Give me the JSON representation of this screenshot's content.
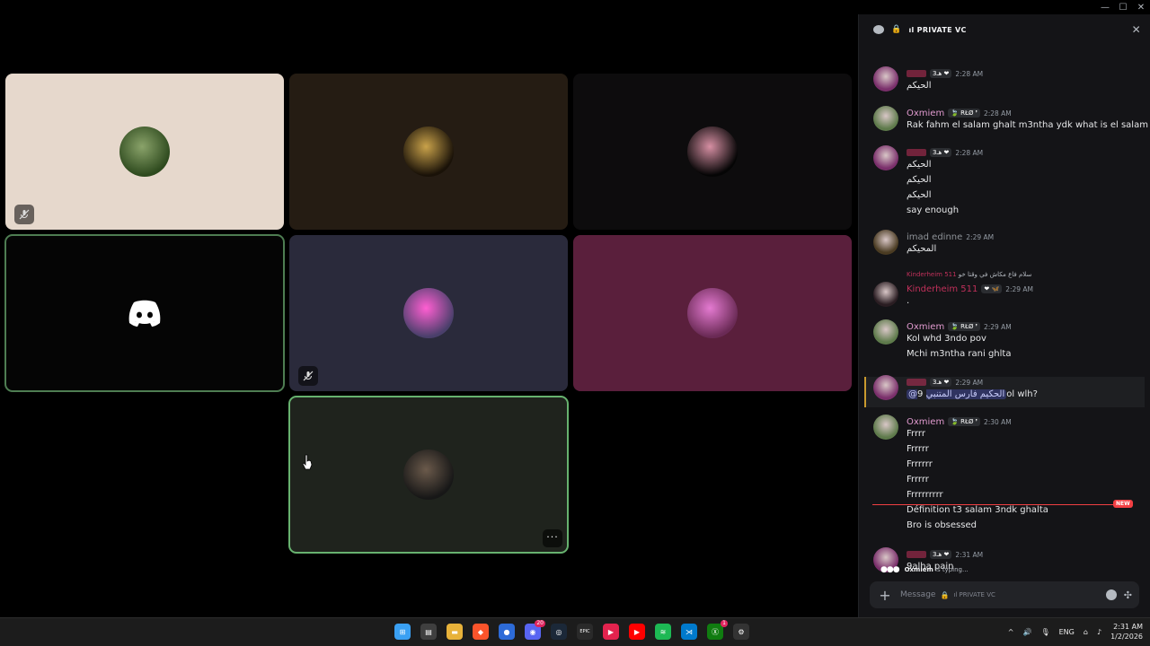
{
  "window_controls": {
    "minimize": "—",
    "maximize": "☐",
    "close": "✕"
  },
  "tiles": [
    {
      "id": "tile-1",
      "bg": "#e6d8cc",
      "avatar_colors": [
        "#2e4a1e",
        "#8aa36a"
      ],
      "muted": true
    },
    {
      "id": "tile-2",
      "bg": "#251c13",
      "avatar_colors": [
        "#1a1208",
        "#c9a24a"
      ],
      "muted": false
    },
    {
      "id": "tile-3",
      "bg": "#0d0c0d",
      "avatar_colors": [
        "#050505",
        "#d68fa3"
      ],
      "muted": false
    },
    {
      "id": "tile-4",
      "bg": "#050505",
      "avatar_colors": [
        "#050505",
        "#050505"
      ],
      "muted": false,
      "discord_logo": true,
      "speaking": true
    },
    {
      "id": "tile-5",
      "bg": "#2a2a3b",
      "avatar_colors": [
        "#4a3f6b",
        "#ff5fd2"
      ],
      "muted": true
    },
    {
      "id": "tile-6",
      "bg": "#5a1f3c",
      "avatar_colors": [
        "#6a2a55",
        "#e47ad1"
      ],
      "muted": false
    },
    {
      "id": "tile-7",
      "bg": "#1f231d",
      "avatar_colors": [
        "#171717",
        "#6b5a4b"
      ],
      "muted": false,
      "speaking": true,
      "more": "···"
    }
  ],
  "chat": {
    "title": "ıl PRIVATE VC",
    "messages": [
      {
        "name": "",
        "name_color": "#c0305a",
        "tag": "ﻫـ3 ❤",
        "time": "2:28 AM",
        "lines": [
          "الحيكم"
        ],
        "pfp": "#7a2f6b"
      },
      {
        "name": "Oxmiem",
        "name_color": "#e29bd0",
        "tag": "🍃 RŁØ ❜",
        "time": "2:28 AM",
        "lines": [
          "Rak fahm el salam ghalt m3ntha ydk what is el salam"
        ],
        "pfp": "#5e7a4b"
      },
      {
        "name": "",
        "name_color": "#c0305a",
        "tag": "ﻫـ3 ❤",
        "time": "2:28 AM",
        "lines": [
          "الحيكم",
          "الحيكم",
          "الحيكم",
          "say enough"
        ],
        "pfp": "#7a2f6b"
      },
      {
        "name": "imad edinne",
        "name_color": "#8e9297",
        "tag": "",
        "time": "2:29 AM",
        "lines": [
          "المحيكم"
        ],
        "pfp": "#4a3b22"
      },
      {
        "reply_text": "سلام فاع مكاش في وقتا خو",
        "reply_name": "Kinderheim 511",
        "name": "Kinderheim 511",
        "name_color": "#c0305a",
        "tag": "❤ 🦋",
        "time": "2:29 AM",
        "lines": [
          "."
        ],
        "pfp": "#2a1d22"
      },
      {
        "name": "Oxmiem",
        "name_color": "#e29bd0",
        "tag": "🍃 RŁØ ❜",
        "time": "2:29 AM",
        "lines": [
          "Kol whd 3ndo pov",
          "Mchi m3ntha rani ghlta"
        ],
        "pfp": "#5e7a4b"
      },
      {
        "name": "",
        "name_color": "#c0305a",
        "tag": "ﻫـ3 ❤",
        "time": "2:29 AM",
        "mention": "@الحكيم فارس المتنبي",
        "lines": [
          "9ol wlh?"
        ],
        "pfp": "#7a2f6b"
      },
      {
        "name": "Oxmiem",
        "name_color": "#e29bd0",
        "tag": "🍃 RŁØ ❜",
        "time": "2:30 AM",
        "lines": [
          "Frrrr",
          "Frrrrr",
          "Frrrrrr",
          "Frrrrr",
          "Frrrrrrrrr",
          "Définition t3 salam 3ndk ghalta",
          "Bro is obsessed"
        ],
        "pfp": "#5e7a4b"
      },
      {
        "name": "",
        "name_color": "#c0305a",
        "tag": "ﻫـ3 ❤",
        "time": "2:31 AM",
        "lines": [
          "9alha pain"
        ],
        "pfp": "#7a2f6b"
      }
    ],
    "new_label": "NEW",
    "typing_user": "Oxmiem",
    "typing_suffix": "is typing...",
    "composer_placeholder": "Message",
    "composer_channel": "ıl PRIVATE VC"
  },
  "taskbar": {
    "icons": [
      {
        "name": "windows-start-icon",
        "color": "#3aa0f3",
        "glyph": "⊞"
      },
      {
        "name": "store-icon",
        "color": "#3f3f3f",
        "glyph": "▤"
      },
      {
        "name": "file-explorer-icon",
        "color": "#e8b23a",
        "glyph": "▬"
      },
      {
        "name": "brave-icon",
        "color": "#fb542b",
        "glyph": "◆"
      },
      {
        "name": "app-icon",
        "color": "#2d6bd8",
        "glyph": "●"
      },
      {
        "name": "discord-icon",
        "color": "#5865f2",
        "glyph": "◉",
        "badge": "20"
      },
      {
        "name": "steam-icon",
        "color": "#1b2838",
        "glyph": "◎"
      },
      {
        "name": "epic-games-icon",
        "color": "#2a2a2a",
        "glyph": "EPIC"
      },
      {
        "name": "media-app-icon",
        "color": "#e2234e",
        "glyph": "▶"
      },
      {
        "name": "youtube-icon",
        "color": "#ff0000",
        "glyph": "▶"
      },
      {
        "name": "spotify-icon",
        "color": "#1db954",
        "glyph": "≋"
      },
      {
        "name": "vscode-icon",
        "color": "#007acc",
        "glyph": "⋊"
      },
      {
        "name": "xbox-icon",
        "color": "#107c10",
        "glyph": "Ⓧ",
        "badge": "1"
      },
      {
        "name": "settings-icon",
        "color": "#333333",
        "glyph": "⚙"
      }
    ],
    "tray": {
      "chevron": "^",
      "lang": "ENG",
      "time": "2:31 AM",
      "date": "1/2/2026"
    }
  }
}
